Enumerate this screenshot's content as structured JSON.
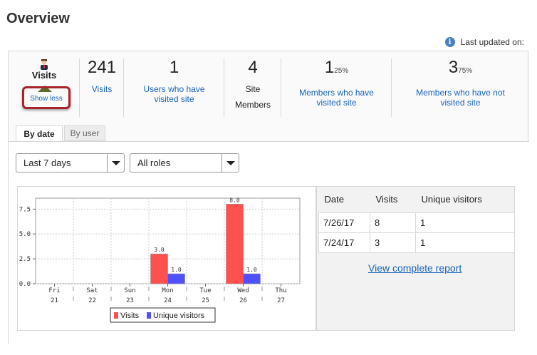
{
  "page_title": "Overview",
  "last_updated_label": "Last updated on:",
  "info_icon": "info-icon",
  "visits_header": {
    "title": "Visits",
    "show_less": "Show less",
    "user_icon": "user-icon"
  },
  "stats": [
    {
      "number": "241",
      "suffix": "",
      "label": "Visits",
      "link": true
    },
    {
      "number": "1",
      "suffix": "",
      "label": "Users who have visited site",
      "link": true
    },
    {
      "number": "4",
      "suffix": "",
      "label": "Site Members",
      "link": false
    },
    {
      "number": "1",
      "suffix": "25%",
      "label": "Members who have visited site",
      "link": true
    },
    {
      "number": "3",
      "suffix": "75%",
      "label": "Members who have not visited site",
      "link": true
    }
  ],
  "tabs": [
    {
      "label": "By date",
      "active": true
    },
    {
      "label": "By user",
      "active": false
    }
  ],
  "filters": {
    "range": "Last 7 days",
    "roles": "All roles"
  },
  "table": {
    "headers": [
      "Date",
      "Visits",
      "Unique visitors"
    ],
    "rows": [
      [
        "7/26/17",
        "8",
        "1"
      ],
      [
        "7/24/17",
        "3",
        "1"
      ]
    ],
    "report_link": "View complete report"
  },
  "colors": {
    "visits": "#ff5050",
    "unique": "#5050ff",
    "link": "#1a64b9",
    "highlight": "#a8232b"
  },
  "chart_data": {
    "type": "bar",
    "categories": [
      "Fri 21",
      "Sat 22",
      "Sun 23",
      "Mon 24",
      "Tue 25",
      "Wed 26",
      "Thu 27"
    ],
    "day_names": [
      "Fri",
      "Sat",
      "Sun",
      "Mon",
      "Tue",
      "Wed",
      "Thu"
    ],
    "day_nums": [
      "21",
      "22",
      "23",
      "24",
      "25",
      "26",
      "27"
    ],
    "series": [
      {
        "name": "Visits",
        "values": [
          0,
          0,
          0,
          3.0,
          0,
          8.0,
          0
        ],
        "labels": [
          "",
          "",
          "",
          "3.0",
          "",
          "8.0",
          ""
        ]
      },
      {
        "name": "Unique visitors",
        "values": [
          0,
          0,
          0,
          1.0,
          0,
          1.0,
          0
        ],
        "labels": [
          "",
          "",
          "",
          "1.0",
          "",
          "1.0",
          ""
        ]
      }
    ],
    "y_ticks": [
      "0.0",
      "2.5",
      "5.0",
      "7.5"
    ],
    "y_tick_values": [
      0,
      2.5,
      5.0,
      7.5
    ],
    "ylim": [
      0,
      8.6
    ],
    "grid": true,
    "legend_position": "bottom"
  }
}
